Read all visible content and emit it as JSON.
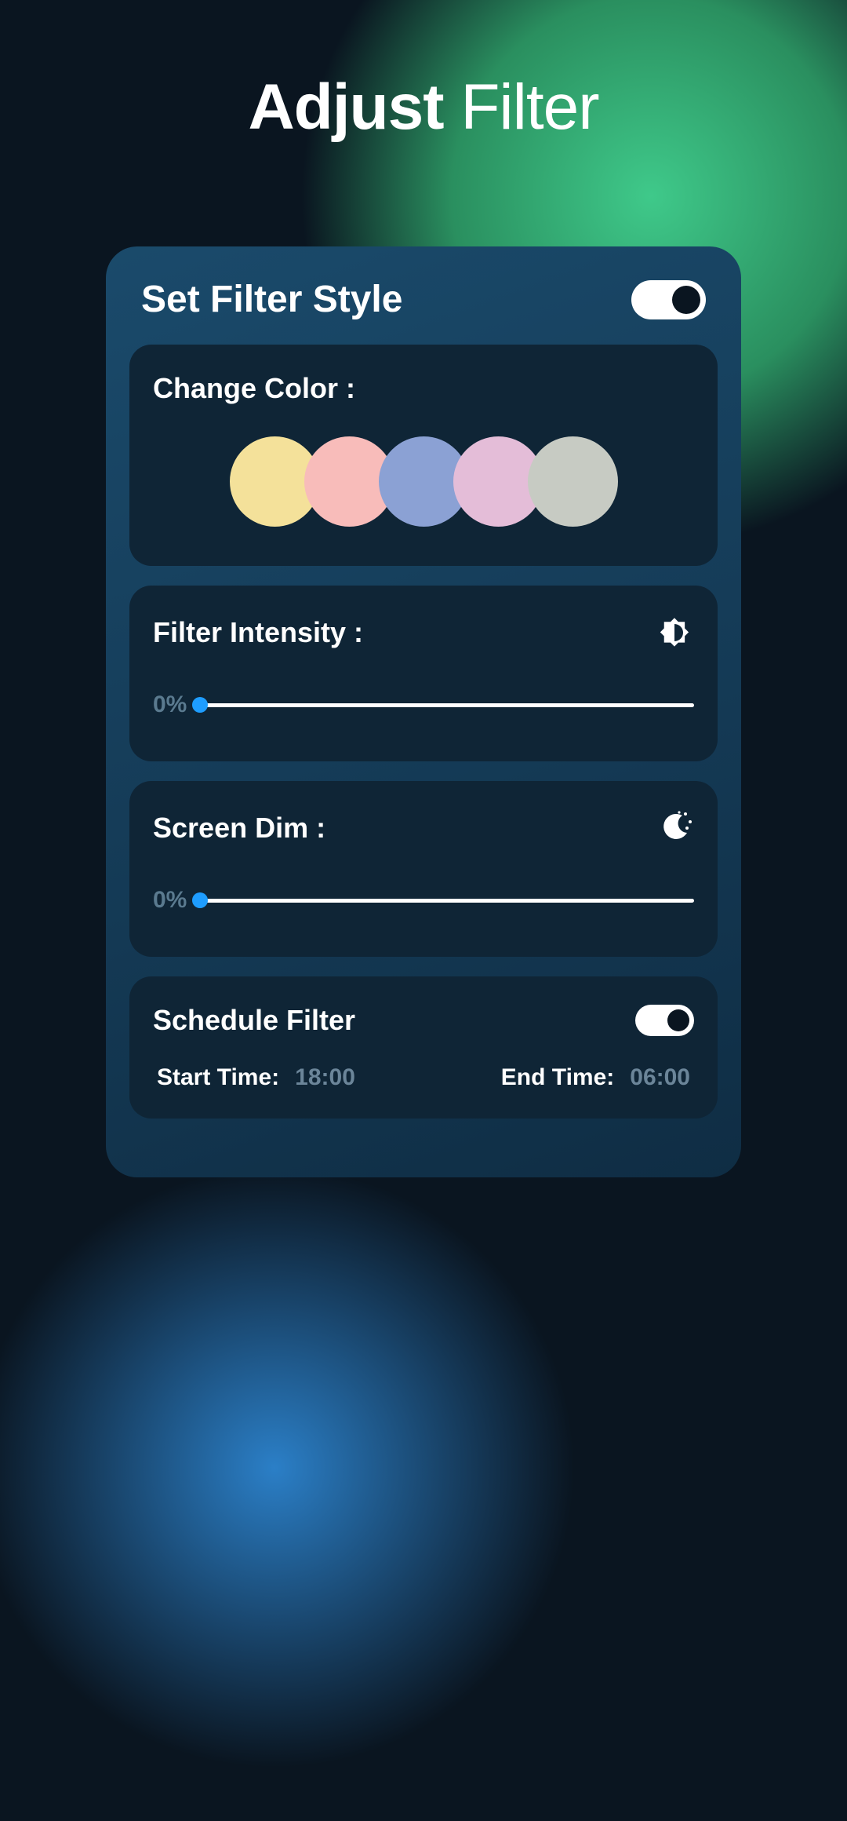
{
  "title": {
    "bold": "Adjust",
    "light": "Filter"
  },
  "panel": {
    "title": "Set Filter Style",
    "toggle_on": true
  },
  "color": {
    "label": "Change Color :",
    "swatches": [
      "#f4e19a",
      "#f8bcba",
      "#8ba1d4",
      "#e4bdd8",
      "#c7cbc3"
    ]
  },
  "intensity": {
    "label": "Filter Intensity :",
    "value": "0%",
    "icon": "brightness-icon"
  },
  "dim": {
    "label": "Screen Dim :",
    "value": "0%",
    "icon": "moon-icon"
  },
  "schedule": {
    "label": "Schedule Filter",
    "toggle_on": true,
    "start_label": "Start Time:",
    "start_value": "18:00",
    "end_label": "End Time:",
    "end_value": "06:00"
  }
}
